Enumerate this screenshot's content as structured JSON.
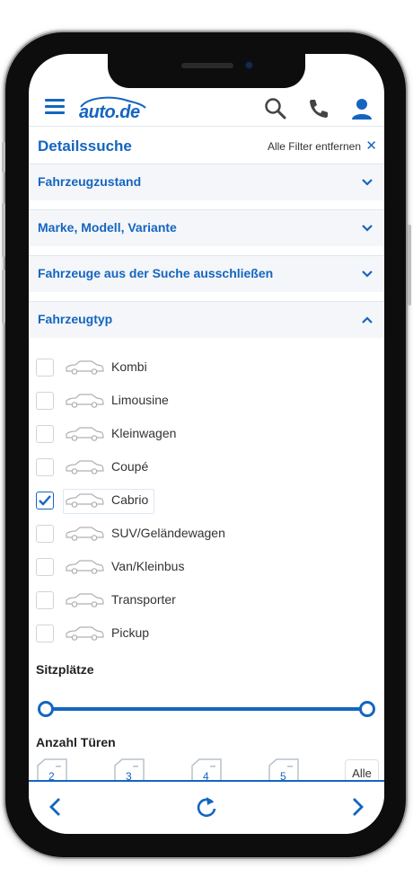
{
  "header": {
    "logo_text": "auto.de",
    "icons": [
      "menu-icon",
      "search-icon",
      "phone-icon",
      "user-icon"
    ]
  },
  "filters": {
    "title": "Detailssuche",
    "clear_label": "Alle Filter entfernen",
    "sections": [
      {
        "label": "Fahrzeugzustand",
        "expanded": false
      },
      {
        "label": "Marke, Modell, Variante",
        "expanded": false
      },
      {
        "label": "Fahrzeuge aus der Suche ausschließen",
        "expanded": false
      },
      {
        "label": "Fahrzeugtyp",
        "expanded": true
      }
    ]
  },
  "vehicle_types": [
    {
      "label": "Kombi",
      "checked": false
    },
    {
      "label": "Limousine",
      "checked": false
    },
    {
      "label": "Kleinwagen",
      "checked": false
    },
    {
      "label": "Coupé",
      "checked": false
    },
    {
      "label": "Cabrio",
      "checked": true
    },
    {
      "label": "SUV/Geländewagen",
      "checked": false
    },
    {
      "label": "Van/Kleinbus",
      "checked": false
    },
    {
      "label": "Transporter",
      "checked": false
    },
    {
      "label": "Pickup",
      "checked": false
    }
  ],
  "seats": {
    "label": "Sitzplätze"
  },
  "doors": {
    "label": "Anzahl Türen",
    "options": [
      "2",
      "3",
      "4",
      "5"
    ],
    "all_label": "Alle"
  },
  "colors": {
    "accent": "#1565c0"
  }
}
